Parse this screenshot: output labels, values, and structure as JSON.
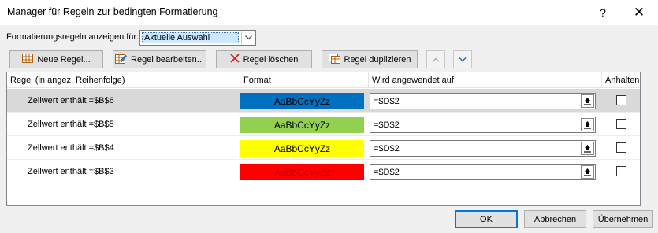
{
  "window": {
    "title": "Manager für Regeln zur bedingten Formatierung",
    "help_glyph": "?",
    "close_glyph": "✕"
  },
  "show_rules": {
    "label": "Formatierungsregeln anzeigen für:",
    "selected": "Aktuelle Auswahl"
  },
  "toolbar": {
    "new_rule": "Neue Regel...",
    "edit_rule": "Regel bearbeiten...",
    "delete_rule": "Regel löschen",
    "duplicate_rule": "Regel duplizieren"
  },
  "table": {
    "headers": {
      "rule": "Regel (in angez. Reihenfolge)",
      "format": "Format",
      "applies_to": "Wird angewendet auf",
      "stop": "Anhalten"
    },
    "rows": [
      {
        "rule": "Zellwert enthält =$B$6",
        "format_preview": "AaBbCcYyZz",
        "format_bg": "#0070c0",
        "format_color": "#000000",
        "applies_to": "=$D$2",
        "stop_if_true": false,
        "selected": true
      },
      {
        "rule": "Zellwert enthält =$B$5",
        "format_preview": "AaBbCcYyZz",
        "format_bg": "#92d050",
        "format_color": "#000000",
        "applies_to": "=$D$2",
        "stop_if_true": false,
        "selected": false
      },
      {
        "rule": "Zellwert enthält =$B$4",
        "format_preview": "AaBbCcYyZz",
        "format_bg": "#ffff00",
        "format_color": "#000000",
        "applies_to": "=$D$2",
        "stop_if_true": false,
        "selected": false
      },
      {
        "rule": "Zellwert enthält =$B$3",
        "format_preview": "AaBbCcYyZz",
        "format_bg": "#ff0000",
        "format_color": "#c00000",
        "applies_to": "=$D$2",
        "stop_if_true": false,
        "selected": false
      }
    ]
  },
  "buttons": {
    "ok": "OK",
    "cancel": "Abbrechen",
    "apply": "Übernehmen"
  },
  "colors": {
    "accent": "#0078d7",
    "selected_row": "#d9d9d9"
  }
}
